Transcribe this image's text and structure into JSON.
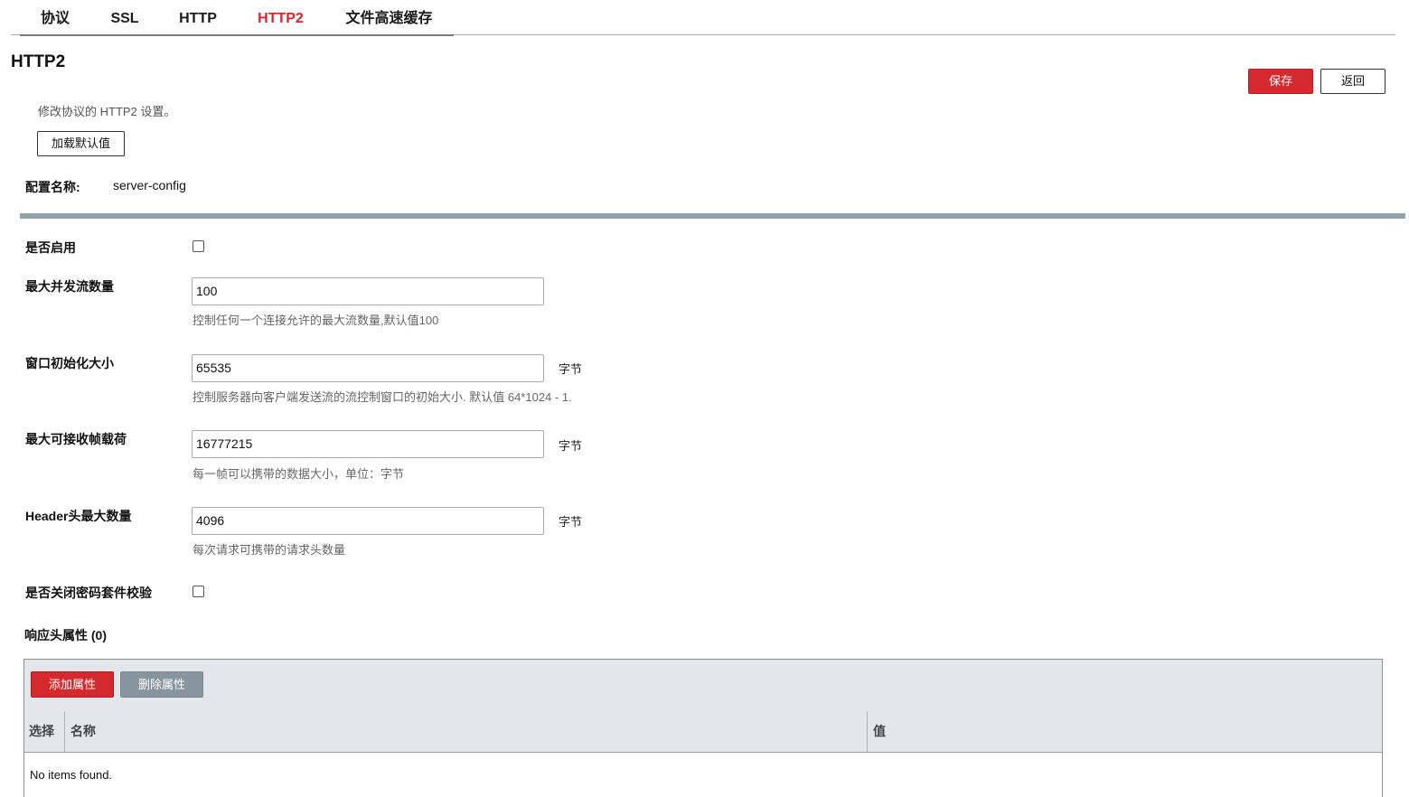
{
  "tabs": [
    {
      "label": "协议"
    },
    {
      "label": "SSL"
    },
    {
      "label": "HTTP"
    },
    {
      "label": "HTTP2",
      "active": true
    },
    {
      "label": "文件高速缓存"
    }
  ],
  "page": {
    "title": "HTTP2",
    "description": "修改协议的 HTTP2 设置。",
    "save_label": "保存",
    "back_label": "返回",
    "load_defaults_label": "加载默认值"
  },
  "config": {
    "name_label": "配置名称:",
    "name_value": "server-config"
  },
  "fields": {
    "enable": {
      "label": "是否启用",
      "checked": false
    },
    "max_concurrent_streams": {
      "label": "最大并发流数量",
      "value": "100",
      "hint": "控制任何一个连接允许的最大流数量,默认值100"
    },
    "initial_window_size": {
      "label": "窗口初始化大小",
      "value": "65535",
      "unit": "字节",
      "hint": "控制服务器向客户端发送流的流控制窗口的初始大小. 默认值 64*1024 - 1."
    },
    "max_frame_size": {
      "label": "最大可接收帧载荷",
      "value": "16777215",
      "unit": "字节",
      "hint": "每一帧可以携带的数据大小，单位：字节"
    },
    "max_header_list_size": {
      "label": "Header头最大数量",
      "value": "4096",
      "unit": "字节",
      "hint": "每次请求可携带的请求头数量"
    },
    "disable_cipher_check": {
      "label": "是否关闭密码套件校验",
      "checked": false
    }
  },
  "response_headers": {
    "title": "响应头属性 (0)",
    "add_label": "添加属性",
    "delete_label": "删除属性",
    "columns": {
      "select": "选择",
      "name": "名称",
      "value": "值"
    },
    "rows": [],
    "empty_text": "No items found."
  },
  "colors": {
    "accent": "#d9262e",
    "section_bar": "#93a3ab",
    "grid_header": "#e3e6ea",
    "delete_button": "#8795a0"
  }
}
